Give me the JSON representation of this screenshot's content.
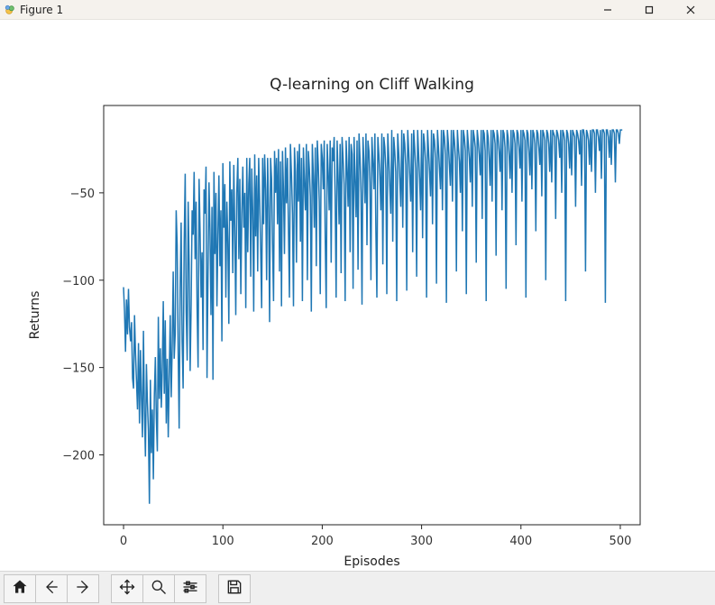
{
  "window": {
    "title": "Figure 1"
  },
  "toolbar": {
    "buttons": [
      {
        "name": "home-button",
        "icon": "home-icon"
      },
      {
        "name": "back-button",
        "icon": "back-icon"
      },
      {
        "name": "forward-button",
        "icon": "forward-icon"
      },
      {
        "name": "pan-button",
        "icon": "move-icon"
      },
      {
        "name": "zoom-button",
        "icon": "zoom-icon"
      },
      {
        "name": "configure-button",
        "icon": "sliders-icon"
      },
      {
        "name": "save-button",
        "icon": "save-icon"
      }
    ]
  },
  "chart_data": {
    "type": "line",
    "title": "Q-learning on Cliff Walking",
    "xlabel": "Episodes",
    "ylabel": "Returns",
    "xlim": [
      -20,
      520
    ],
    "ylim": [
      -240,
      0
    ],
    "xticks": [
      0,
      100,
      200,
      300,
      400,
      500
    ],
    "yticks": [
      -200,
      -150,
      -100,
      -50
    ],
    "series": [
      {
        "name": "returns",
        "color": "#1f77b4",
        "x_start": 0,
        "x_step": 1,
        "values": [
          -104,
          -118,
          -141,
          -111,
          -131,
          -105,
          -127,
          -135,
          -124,
          -156,
          -162,
          -120,
          -142,
          -158,
          -174,
          -136,
          -182,
          -140,
          -168,
          -190,
          -129,
          -175,
          -201,
          -148,
          -170,
          -186,
          -228,
          -157,
          -199,
          -174,
          -214,
          -166,
          -144,
          -179,
          -198,
          -121,
          -168,
          -139,
          -173,
          -150,
          -112,
          -165,
          -123,
          -182,
          -145,
          -190,
          -154,
          -120,
          -167,
          -138,
          -95,
          -145,
          -131,
          -60,
          -80,
          -140,
          -185,
          -105,
          -67,
          -135,
          -162,
          -78,
          -39,
          -118,
          -146,
          -55,
          -92,
          -152,
          -114,
          -60,
          -74,
          -38,
          -88,
          -55,
          -116,
          -150,
          -42,
          -72,
          -110,
          -84,
          -140,
          -48,
          -62,
          -35,
          -156,
          -95,
          -44,
          -72,
          -120,
          -58,
          -157,
          -38,
          -85,
          -50,
          -115,
          -74,
          -40,
          -92,
          -60,
          -135,
          -33,
          -70,
          -45,
          -110,
          -55,
          -78,
          -125,
          -32,
          -66,
          -48,
          -96,
          -34,
          -72,
          -120,
          -50,
          -30,
          -88,
          -42,
          -108,
          -62,
          -35,
          -70,
          -50,
          -116,
          -30,
          -84,
          -45,
          -30,
          -98,
          -36,
          -60,
          -118,
          -28,
          -75,
          -40,
          -95,
          -30,
          -55,
          -82,
          -116,
          -30,
          -68,
          -28,
          -48,
          -100,
          -30,
          -58,
          -124,
          -30,
          -42,
          -80,
          -112,
          -26,
          -50,
          -30,
          -68,
          -25,
          -95,
          -32,
          -115,
          -26,
          -48,
          -85,
          -24,
          -56,
          -30,
          -70,
          -110,
          -22,
          -40,
          -62,
          -115,
          -24,
          -38,
          -90,
          -26,
          -55,
          -22,
          -78,
          -30,
          -112,
          -24,
          -44,
          -60,
          -22,
          -100,
          -26,
          -36,
          -52,
          -118,
          -22,
          -40,
          -70,
          -24,
          -92,
          -20,
          -34,
          -55,
          -108,
          -22,
          -30,
          -48,
          -20,
          -76,
          -116,
          -22,
          -38,
          -60,
          -20,
          -90,
          -24,
          -32,
          -18,
          -52,
          -110,
          -20,
          -40,
          -68,
          -22,
          -96,
          -18,
          -30,
          -45,
          -112,
          -20,
          -36,
          -58,
          -18,
          -84,
          -22,
          -28,
          -105,
          -18,
          -42,
          -64,
          -20,
          -94,
          -16,
          -30,
          -50,
          -114,
          -18,
          -34,
          -56,
          -16,
          -80,
          -20,
          -26,
          -44,
          -100,
          -18,
          -32,
          -48,
          -16,
          -72,
          -110,
          -18,
          -28,
          -40,
          -60,
          -16,
          -91,
          -18,
          -24,
          -36,
          -108,
          -16,
          -30,
          -46,
          -62,
          -14,
          -78,
          -18,
          -26,
          -38,
          -112,
          -16,
          -28,
          -42,
          -58,
          -14,
          -70,
          -16,
          -22,
          -34,
          -106,
          -14,
          -26,
          -40,
          -55,
          -16,
          -84,
          -14,
          -24,
          -36,
          -98,
          -14,
          -28,
          -42,
          -60,
          -14,
          -76,
          -16,
          -22,
          -32,
          -110,
          -14,
          -26,
          -38,
          -52,
          -14,
          -68,
          -16,
          -20,
          -30,
          -102,
          -14,
          -24,
          -36,
          -48,
          -14,
          -60,
          -14,
          -18,
          -28,
          -113,
          -14,
          -22,
          -34,
          -46,
          -14,
          -55,
          -14,
          -20,
          -30,
          -95,
          -14,
          -24,
          -32,
          -50,
          -14,
          -72,
          -14,
          -18,
          -26,
          -108,
          -14,
          -22,
          -30,
          -44,
          -14,
          -58,
          -14,
          -18,
          -24,
          -90,
          -14,
          -20,
          -28,
          -40,
          -14,
          -65,
          -14,
          -16,
          -26,
          -112,
          -14,
          -18,
          -30,
          -46,
          -14,
          -55,
          -14,
          -16,
          -22,
          -86,
          -14,
          -18,
          -26,
          -38,
          -14,
          -60,
          -14,
          -16,
          -24,
          -105,
          -14,
          -18,
          -28,
          -42,
          -14,
          -50,
          -14,
          -16,
          -22,
          -80,
          -14,
          -16,
          -24,
          -36,
          -14,
          -55,
          -14,
          -16,
          -20,
          -110,
          -14,
          -16,
          -26,
          -40,
          -14,
          -48,
          -14,
          -16,
          -22,
          -72,
          -14,
          -16,
          -24,
          -34,
          -14,
          -52,
          -14,
          -16,
          -20,
          -100,
          -14,
          -16,
          -22,
          -38,
          -14,
          -44,
          -14,
          -16,
          -18,
          -65,
          -14,
          -16,
          -20,
          -30,
          -14,
          -50,
          -14,
          -16,
          -20,
          -112,
          -14,
          -16,
          -22,
          -36,
          -14,
          -40,
          -14,
          -16,
          -18,
          -58,
          -14,
          -16,
          -20,
          -28,
          -14,
          -46,
          -14,
          -14,
          -18,
          -95,
          -14,
          -16,
          -20,
          -34,
          -14,
          -38,
          -14,
          -14,
          -16,
          -50,
          -14,
          -14,
          -18,
          -26,
          -14,
          -42,
          -14,
          -14,
          -16,
          -113,
          -14,
          -14,
          -18,
          -30,
          -14,
          -34,
          -14,
          -14,
          -16,
          -44,
          -14,
          -14,
          -16,
          -22,
          -14,
          -14,
          -14
        ]
      }
    ]
  }
}
